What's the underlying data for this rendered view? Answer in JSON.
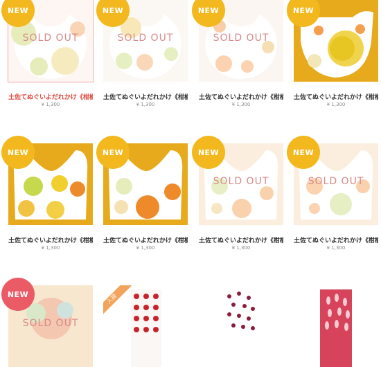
{
  "colors": {
    "badge_yellow": "#f2b81d",
    "badge_red": "#ea5b66",
    "title_highlight": "#e0463c",
    "sold_out_text": "#d88a8a",
    "ribbon_orange": "#f3a45c"
  },
  "products": [
    {
      "badge": "NEW",
      "sold_out": "SOLD OUT",
      "title": "土佐てぬぐいよだれかけ《柑橘…",
      "price": "¥ 1,300"
    },
    {
      "badge": "NEW",
      "sold_out": "SOLD OUT",
      "title": "土佐てぬぐいよだれかけ《柑橘…",
      "price": "¥ 1,300"
    },
    {
      "badge": "NEW",
      "sold_out": "SOLD OUT",
      "title": "土佐てぬぐいよだれかけ《柑橘…",
      "price": "¥ 1,300"
    },
    {
      "badge": "NEW",
      "sold_out": "",
      "title": "土佐てぬぐいよだれかけ《柑橘…",
      "price": "¥ 1,300"
    },
    {
      "badge": "NEW",
      "sold_out": "",
      "title": "土佐てぬぐいよだれかけ《柑橘…",
      "price": "¥ 1,300"
    },
    {
      "badge": "NEW",
      "sold_out": "",
      "title": "土佐てぬぐいよだれかけ《柑橘…",
      "price": "¥ 1,300"
    },
    {
      "badge": "NEW",
      "sold_out": "SOLD OUT",
      "title": "土佐てぬぐいよだれかけ《柑橘…",
      "price": "¥ 1,300"
    },
    {
      "badge": "NEW",
      "sold_out": "SOLD OUT",
      "title": "土佐てぬぐいよだれかけ《柑橘…",
      "price": "¥ 1,300"
    },
    {
      "badge": "NEW",
      "sold_out": "SOLD OUT",
      "title": "",
      "price": ""
    },
    {
      "badge": "",
      "ribbon": "入荷",
      "sold_out": "",
      "title": "",
      "price": ""
    },
    {
      "badge": "",
      "sold_out": "",
      "title": "",
      "price": ""
    },
    {
      "badge": "",
      "sold_out": "",
      "title": "",
      "price": ""
    }
  ]
}
